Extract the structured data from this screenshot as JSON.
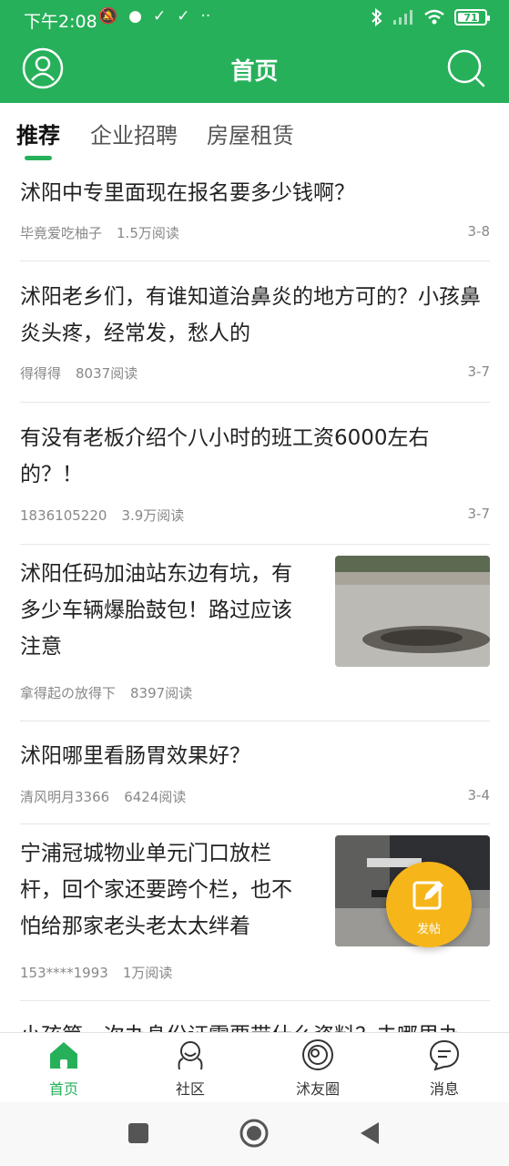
{
  "status_bar": {
    "time": "下午2:08",
    "battery": "71"
  },
  "header": {
    "title": "首页"
  },
  "tabs": [
    {
      "label": "推荐",
      "active": true
    },
    {
      "label": "企业招聘",
      "active": false
    },
    {
      "label": "房屋租赁",
      "active": false
    }
  ],
  "posts": [
    {
      "title": "沭阳中专里面现在报名要多少钱啊？",
      "author": "毕竟爱吃柚子",
      "reads": "1.5万阅读",
      "date": "3-8"
    },
    {
      "title": "沭阳老乡们，有谁知道治鼻炎的地方可的？小孩鼻炎头疼，经常发，愁人的",
      "author": "得得得",
      "reads": "8037阅读",
      "date": "3-7"
    },
    {
      "title": "有没有老板介绍个八小时的班工资6000左右的？！",
      "author": "1836105220",
      "reads": "3.9万阅读",
      "date": "3-7"
    },
    {
      "title": "沭阳任码加油站东边有坑，有多少车辆爆胎鼓包！路过应该注意",
      "author": "拿得起の放得下",
      "reads": "8397阅读",
      "date": ""
    },
    {
      "title": "沭阳哪里看肠胃效果好？",
      "author": "清风明月3366",
      "reads": "6424阅读",
      "date": "3-4"
    },
    {
      "title": "宁浦冠城物业单元门口放栏杆，回个家还要跨个栏，也不怕给那家老头老太太绊着",
      "author": "153****1993",
      "reads": "1万阅读",
      "date": ""
    },
    {
      "title": "小孩第一次办身份证需要带什么资料？去哪里办",
      "author": "",
      "reads": "",
      "date": ""
    }
  ],
  "fab": {
    "label": "发帖"
  },
  "bottom_nav": [
    {
      "label": "首页",
      "icon": "home-icon",
      "active": true
    },
    {
      "label": "社区",
      "icon": "community-icon",
      "active": false
    },
    {
      "label": "沭友圈",
      "icon": "moments-icon",
      "active": false
    },
    {
      "label": "消息",
      "icon": "message-icon",
      "active": false
    }
  ],
  "colors": {
    "brand": "#27b05a",
    "fab": "#f6b619"
  }
}
